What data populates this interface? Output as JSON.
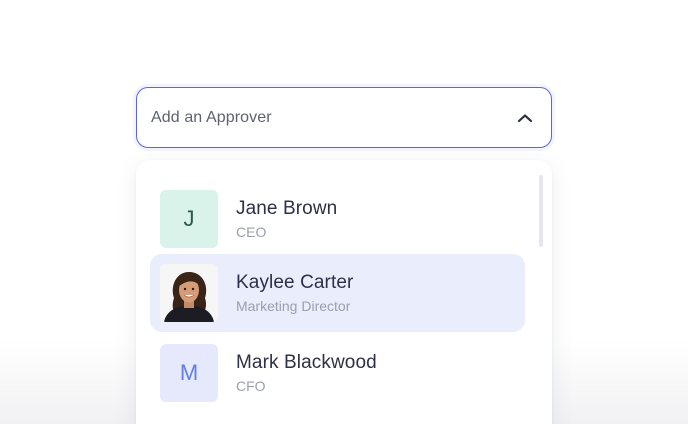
{
  "field": {
    "placeholder": "Add an Approver",
    "accent": "#5b63e8"
  },
  "options": [
    {
      "initial": "J",
      "name": "Jane Brown",
      "role": "CEO",
      "avatar_bg": "#daf3ea",
      "avatar_fg": "#2e5a4a",
      "selected": false
    },
    {
      "initial": "",
      "name": "Kaylee Carter",
      "role": "Marketing Director",
      "avatar": "photo",
      "selected": true
    },
    {
      "initial": "M",
      "name": "Mark Blackwood",
      "role": "CFO",
      "avatar_bg": "#e6e9fb",
      "avatar_fg": "#5f7ee8",
      "selected": false
    }
  ]
}
